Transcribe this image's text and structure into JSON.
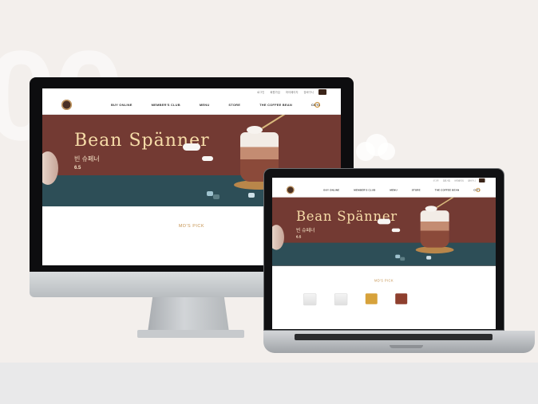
{
  "site": {
    "topbar": [
      "로그인",
      "회원가입",
      "마이페이지",
      "장바구니"
    ],
    "menu": [
      "BUY ONLINE",
      "MEMBER'S CLUB",
      "MENU",
      "STORE",
      "THE COFFEE BEAN",
      "CBTL"
    ],
    "hero": {
      "title": "Bean Spänner",
      "subtitle": "빈 슈페너",
      "date": "6.5"
    },
    "section_title": "MD'S PICK"
  },
  "colors": {
    "hero_brown": "#733a33",
    "hero_teal": "#2d4e57",
    "accent_gold": "#c69452",
    "background": "#f3efec"
  },
  "icons": [
    "logo-icon",
    "search-icon",
    "cart-icon"
  ]
}
